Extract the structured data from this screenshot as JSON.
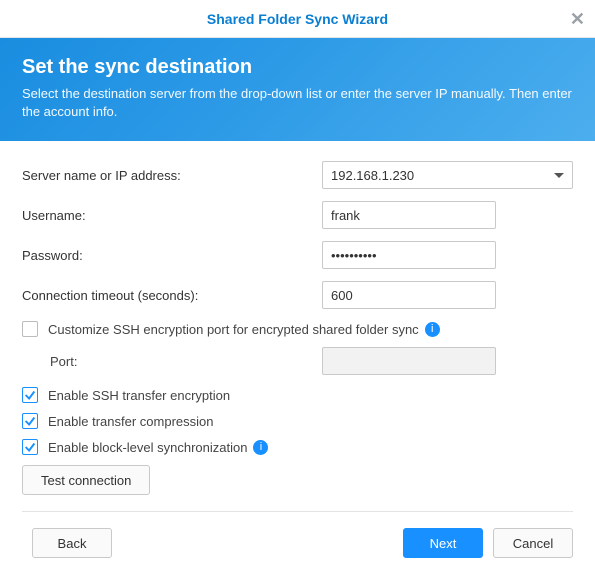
{
  "title": "Shared Folder Sync Wizard",
  "hero": {
    "heading": "Set the sync destination",
    "subtext": "Select the destination server from the drop-down list or enter the server IP manually. Then enter the account info."
  },
  "form": {
    "server_label": "Server name or IP address:",
    "server_value": "192.168.1.230",
    "username_label": "Username:",
    "username_value": "frank",
    "password_label": "Password:",
    "password_value": "••••••••••",
    "timeout_label": "Connection timeout (seconds):",
    "timeout_value": "600",
    "customize_port_label": "Customize SSH encryption port for encrypted shared folder sync",
    "port_label": "Port:",
    "port_value": "",
    "ssh_enc_label": "Enable SSH transfer encryption",
    "compress_label": "Enable transfer compression",
    "block_sync_label": "Enable block-level synchronization",
    "test_btn": "Test connection"
  },
  "checks": {
    "customize_port": false,
    "ssh_enc": true,
    "compress": true,
    "block_sync": true
  },
  "footer": {
    "back": "Back",
    "next": "Next",
    "cancel": "Cancel"
  }
}
